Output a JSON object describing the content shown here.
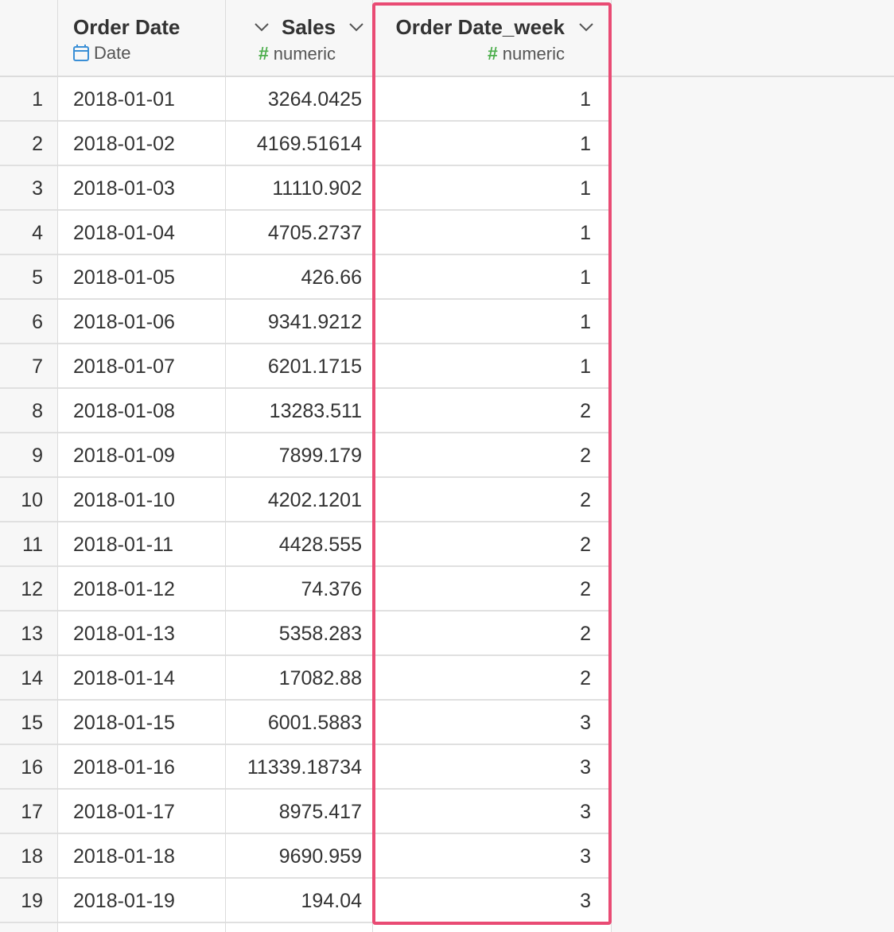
{
  "columns": [
    {
      "title": "Order Date",
      "type_label": "Date",
      "type_icon": "calendar-icon"
    },
    {
      "title": "Sales",
      "type_label": "numeric",
      "type_icon": "#"
    },
    {
      "title": "Order Date_week",
      "type_label": "numeric",
      "type_icon": "#"
    }
  ],
  "rows": [
    {
      "index": "1",
      "order_date": "2018-01-01",
      "sales": "3264.0425",
      "week": "1"
    },
    {
      "index": "2",
      "order_date": "2018-01-02",
      "sales": "4169.51614",
      "week": "1"
    },
    {
      "index": "3",
      "order_date": "2018-01-03",
      "sales": "11110.902",
      "week": "1"
    },
    {
      "index": "4",
      "order_date": "2018-01-04",
      "sales": "4705.2737",
      "week": "1"
    },
    {
      "index": "5",
      "order_date": "2018-01-05",
      "sales": "426.66",
      "week": "1"
    },
    {
      "index": "6",
      "order_date": "2018-01-06",
      "sales": "9341.9212",
      "week": "1"
    },
    {
      "index": "7",
      "order_date": "2018-01-07",
      "sales": "6201.1715",
      "week": "1"
    },
    {
      "index": "8",
      "order_date": "2018-01-08",
      "sales": "13283.511",
      "week": "2"
    },
    {
      "index": "9",
      "order_date": "2018-01-09",
      "sales": "7899.179",
      "week": "2"
    },
    {
      "index": "10",
      "order_date": "2018-01-10",
      "sales": "4202.1201",
      "week": "2"
    },
    {
      "index": "11",
      "order_date": "2018-01-11",
      "sales": "4428.555",
      "week": "2"
    },
    {
      "index": "12",
      "order_date": "2018-01-12",
      "sales": "74.376",
      "week": "2"
    },
    {
      "index": "13",
      "order_date": "2018-01-13",
      "sales": "5358.283",
      "week": "2"
    },
    {
      "index": "14",
      "order_date": "2018-01-14",
      "sales": "17082.88",
      "week": "2"
    },
    {
      "index": "15",
      "order_date": "2018-01-15",
      "sales": "6001.5883",
      "week": "3"
    },
    {
      "index": "16",
      "order_date": "2018-01-16",
      "sales": "11339.18734",
      "week": "3"
    },
    {
      "index": "17",
      "order_date": "2018-01-17",
      "sales": "8975.417",
      "week": "3"
    },
    {
      "index": "18",
      "order_date": "2018-01-18",
      "sales": "9690.959",
      "week": "3"
    },
    {
      "index": "19",
      "order_date": "2018-01-19",
      "sales": "194.04",
      "week": "3"
    }
  ],
  "colors": {
    "highlight_border": "#e94b74",
    "numeric_icon": "#4cae4c",
    "date_icon": "#3a8fd6",
    "header_bg": "#f7f7f7"
  }
}
